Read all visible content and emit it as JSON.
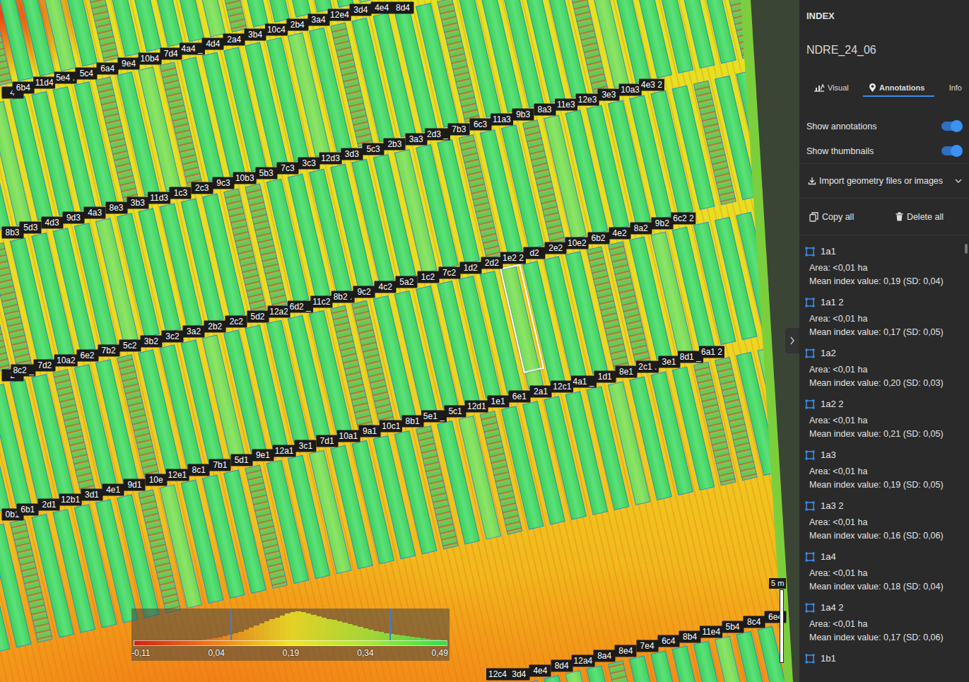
{
  "map": {
    "rows": [
      {
        "items": [
          {
            "t": "4",
            "selected": false
          },
          {
            "t": "6b4",
            "selected": false
          },
          {
            "t": "11d4",
            "selected": false
          },
          {
            "t": "5e4 .",
            "selected": false
          },
          {
            "t": "5c4",
            "selected": false
          },
          {
            "t": "6a4",
            "selected": false
          },
          {
            "t": "9e4",
            "selected": false
          },
          {
            "t": "10b4",
            "selected": false
          },
          {
            "t": "7d4",
            "selected": false
          },
          {
            "t": "4a4 _",
            "selected": false
          },
          {
            "t": "4d4",
            "selected": false
          },
          {
            "t": "2a4",
            "selected": false
          },
          {
            "t": "3b4",
            "selected": false
          },
          {
            "t": "10c4",
            "selected": false
          },
          {
            "t": "2b4",
            "selected": false
          },
          {
            "t": "3a4",
            "selected": false
          },
          {
            "t": "12e4",
            "selected": false
          },
          {
            "t": "3d4",
            "selected": false
          },
          {
            "t": "4e4",
            "selected": false
          },
          {
            "t": "8d4",
            "selected": false
          }
        ]
      },
      {
        "items": [
          {
            "t": "8b3",
            "selected": false
          },
          {
            "t": "5d3",
            "selected": false
          },
          {
            "t": "4d3",
            "selected": false
          },
          {
            "t": "9d3",
            "selected": false
          },
          {
            "t": "4a3",
            "selected": false
          },
          {
            "t": "8e3",
            "selected": false
          },
          {
            "t": "3b3",
            "selected": false
          },
          {
            "t": "11d3",
            "selected": false
          },
          {
            "t": "1c3",
            "selected": false
          },
          {
            "t": "2c3",
            "selected": false
          },
          {
            "t": "9c3",
            "selected": false
          },
          {
            "t": "10b3",
            "selected": false
          },
          {
            "t": "5b3",
            "selected": false
          },
          {
            "t": "7c3",
            "selected": false
          },
          {
            "t": "3c3",
            "selected": false
          },
          {
            "t": "12d3",
            "selected": false
          },
          {
            "t": "3d3",
            "selected": false
          },
          {
            "t": "5c3",
            "selected": false
          },
          {
            "t": "2b3",
            "selected": false
          },
          {
            "t": "3a3",
            "selected": false
          },
          {
            "t": "2d3 _",
            "selected": false
          },
          {
            "t": "7b3",
            "selected": false
          },
          {
            "t": "6c3",
            "selected": false
          },
          {
            "t": "11a3",
            "selected": false
          },
          {
            "t": "9b3",
            "selected": false
          },
          {
            "t": "8a3",
            "selected": false
          },
          {
            "t": "11e3",
            "selected": false
          },
          {
            "t": "12e3",
            "selected": false
          },
          {
            "t": "3e3",
            "selected": false
          },
          {
            "t": "10a3",
            "selected": false
          },
          {
            "t": "4e3 2",
            "selected": false
          }
        ]
      },
      {
        "items": [
          {
            "t": "2",
            "selected": false
          },
          {
            "t": "8c2 _",
            "selected": false
          },
          {
            "t": "7d2",
            "selected": false
          },
          {
            "t": "10a2",
            "selected": false
          },
          {
            "t": "6e2",
            "selected": false
          },
          {
            "t": "7b2",
            "selected": false
          },
          {
            "t": "5c2",
            "selected": false
          },
          {
            "t": "3b2",
            "selected": false
          },
          {
            "t": "3c2",
            "selected": false
          },
          {
            "t": "3a2",
            "selected": false
          },
          {
            "t": "2b2",
            "selected": false
          },
          {
            "t": "2c2",
            "selected": false
          },
          {
            "t": "5d2",
            "selected": false
          },
          {
            "t": "12a2",
            "selected": false
          },
          {
            "t": "6d2 _",
            "selected": false
          },
          {
            "t": "11c2",
            "selected": false
          },
          {
            "t": "8b2 .",
            "selected": false
          },
          {
            "t": "9c2",
            "selected": false
          },
          {
            "t": "4c2",
            "selected": false
          },
          {
            "t": "5a2",
            "selected": false
          },
          {
            "t": "1c2",
            "selected": false
          },
          {
            "t": "7c2",
            "selected": false
          },
          {
            "t": "1d2",
            "selected": false
          },
          {
            "t": "2d2",
            "selected": false
          },
          {
            "t": "1e2 2",
            "selected": true
          },
          {
            "t": "d2",
            "selected": false
          },
          {
            "t": "2e2",
            "selected": false
          },
          {
            "t": "10e2",
            "selected": false
          },
          {
            "t": "6b2",
            "selected": false
          },
          {
            "t": "4e2",
            "selected": false
          },
          {
            "t": "8a2",
            "selected": false
          },
          {
            "t": "9b2",
            "selected": false
          },
          {
            "t": "6c2 2",
            "selected": false
          }
        ]
      },
      {
        "items": [
          {
            "t": "0b1",
            "selected": false
          },
          {
            "t": "6b1",
            "selected": false
          },
          {
            "t": "2d1",
            "selected": false
          },
          {
            "t": "12b1",
            "selected": false
          },
          {
            "t": "3d1",
            "selected": false
          },
          {
            "t": "4e1",
            "selected": false
          },
          {
            "t": "9d1",
            "selected": false
          },
          {
            "t": "10e",
            "selected": false
          },
          {
            "t": "12e1",
            "selected": false
          },
          {
            "t": "8c1",
            "selected": false
          },
          {
            "t": "7b1",
            "selected": false
          },
          {
            "t": "5d1",
            "selected": false
          },
          {
            "t": "9e1",
            "selected": false
          },
          {
            "t": "12a1",
            "selected": false
          },
          {
            "t": "3c1",
            "selected": false
          },
          {
            "t": "7d1",
            "selected": false
          },
          {
            "t": "10a1",
            "selected": false
          },
          {
            "t": "9a1",
            "selected": false
          },
          {
            "t": "10c1",
            "selected": false
          },
          {
            "t": "8b1",
            "selected": false
          },
          {
            "t": "5e1 _",
            "selected": false
          },
          {
            "t": "5c1",
            "selected": false
          },
          {
            "t": "12d1",
            "selected": false
          },
          {
            "t": "1e1",
            "selected": false
          },
          {
            "t": "6e1",
            "selected": false
          },
          {
            "t": "2a1",
            "selected": false
          },
          {
            "t": "12c1",
            "selected": false
          },
          {
            "t": "4a1 _",
            "selected": false
          },
          {
            "t": "1d1",
            "selected": false
          },
          {
            "t": "8e1",
            "selected": false
          },
          {
            "t": "2c1 .",
            "selected": false
          },
          {
            "t": "3e1",
            "selected": false
          },
          {
            "t": "8d1 _",
            "selected": false
          },
          {
            "t": "6a1 2",
            "selected": false
          }
        ]
      },
      {
        "items": [
          {
            "t": "12c4",
            "selected": false
          },
          {
            "t": "3d4",
            "selected": false
          },
          {
            "t": "4e4",
            "selected": false
          },
          {
            "t": "8d4",
            "selected": false
          },
          {
            "t": "12a4",
            "selected": false
          },
          {
            "t": "8a4",
            "selected": false
          },
          {
            "t": "8e4",
            "selected": false
          },
          {
            "t": "7e4",
            "selected": false
          },
          {
            "t": "6c4",
            "selected": false
          },
          {
            "t": "8b4",
            "selected": false
          },
          {
            "t": "11e4",
            "selected": false
          },
          {
            "t": "5b4",
            "selected": false
          },
          {
            "t": "8c4",
            "selected": false
          },
          {
            "t": "6e4",
            "selected": false
          }
        ]
      }
    ],
    "legend": {
      "ticks": [
        "-0,11",
        "0,04",
        "0,19",
        "0,34",
        "0,49"
      ],
      "histogram": [
        0,
        0,
        0,
        0,
        0,
        0,
        0,
        0,
        1,
        1,
        1,
        2,
        3,
        4,
        6,
        8,
        11,
        14,
        18,
        23,
        28,
        34,
        40,
        46,
        52,
        58,
        64,
        70,
        76,
        82,
        86,
        88,
        86,
        82,
        78,
        74,
        70,
        66,
        62,
        58,
        54,
        50,
        46,
        42,
        38,
        34,
        30,
        27,
        24,
        21,
        18,
        16,
        14,
        12,
        10,
        8,
        6,
        5,
        4,
        3
      ],
      "handles": [
        0.075,
        0.38
      ]
    },
    "scale": "5 m"
  },
  "sidebar": {
    "header": "INDEX",
    "title": "NDRE_24_06",
    "tabs": [
      {
        "label": "Visual",
        "selected": false
      },
      {
        "label": "Annotations",
        "selected": true
      },
      {
        "label": "Info",
        "selected": false
      }
    ],
    "toggles": [
      {
        "label": "Show annotations",
        "on": true
      },
      {
        "label": "Show thumbnails",
        "on": true
      }
    ],
    "import": "Import geometry files or images",
    "actions": [
      "Copy all",
      "Delete all"
    ],
    "annotations": [
      {
        "name": "1a1",
        "area": "Area: <0,01 ha",
        "mean": "Mean index value: 0,19 (SD: 0,04)"
      },
      {
        "name": "1a1 2",
        "area": "Area: <0,01 ha",
        "mean": "Mean index value: 0,17 (SD: 0,05)"
      },
      {
        "name": "1a2",
        "area": "Area: <0,01 ha",
        "mean": "Mean index value: 0,20 (SD: 0,03)"
      },
      {
        "name": "1a2 2",
        "area": "Area: <0,01 ha",
        "mean": "Mean index value: 0,21 (SD: 0,05)"
      },
      {
        "name": "1a3",
        "area": "Area: <0,01 ha",
        "mean": "Mean index value: 0,19 (SD: 0,05)"
      },
      {
        "name": "1a3 2",
        "area": "Area: <0,01 ha",
        "mean": "Mean index value: 0,16 (SD: 0,06)"
      },
      {
        "name": "1a4",
        "area": "Area: <0,01 ha",
        "mean": "Mean index value: 0,18 (SD: 0,04)"
      },
      {
        "name": "1a4 2",
        "area": "Area: <0,01 ha",
        "mean": "Mean index value: 0,17 (SD: 0,06)"
      },
      {
        "name": "1b1"
      }
    ]
  }
}
